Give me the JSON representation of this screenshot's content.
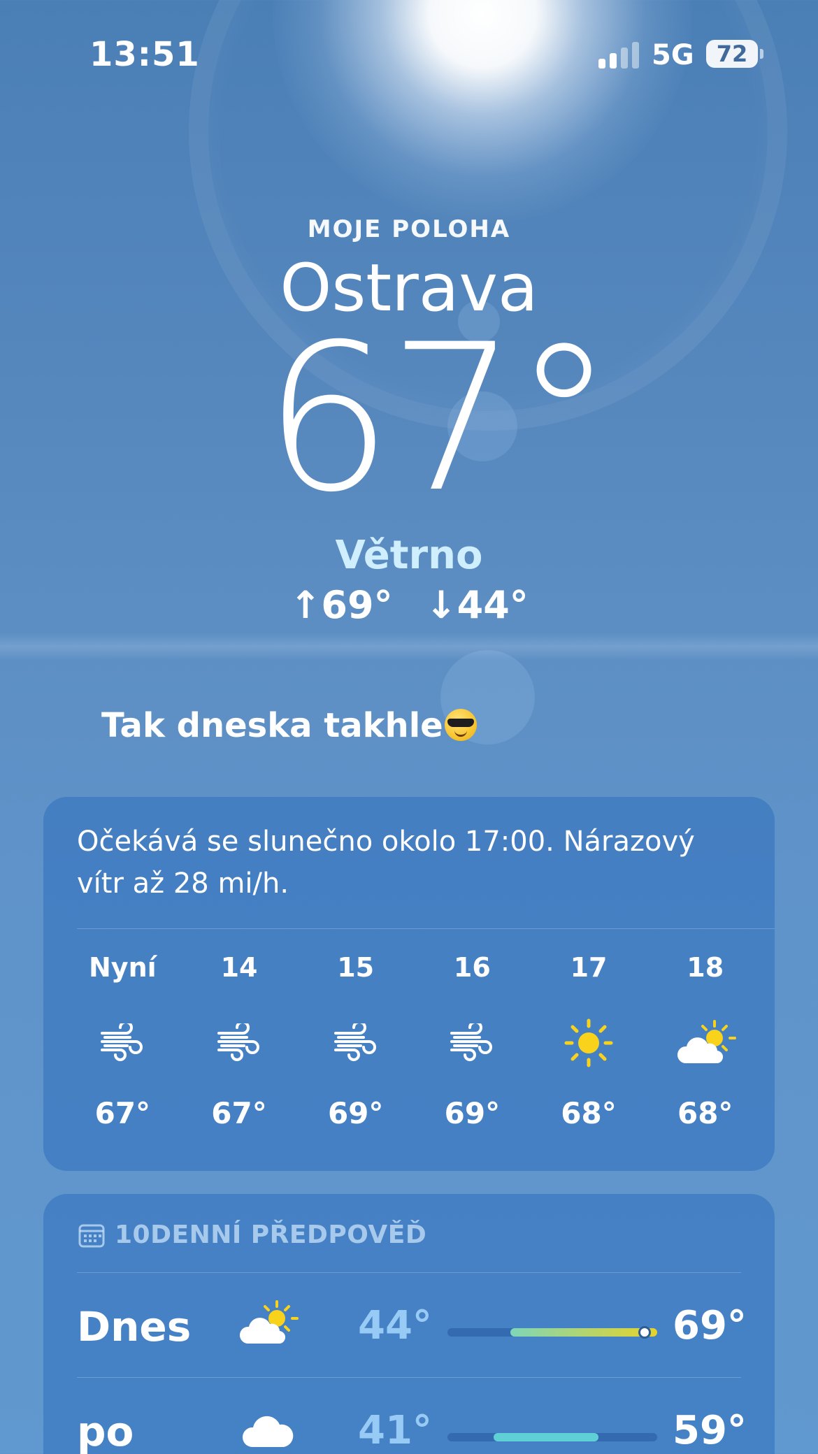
{
  "status_bar": {
    "time": "13:51",
    "network": "5G",
    "battery": "72"
  },
  "header": {
    "location_label": "MOJE POLOHA",
    "city": "Ostrava",
    "temperature": "67°",
    "condition": "Větrno",
    "high": "↑69°",
    "low": "↓44°"
  },
  "caption": "Tak dneska takhle",
  "hourly": {
    "summary": "Očekává se slunečno okolo 17:00. Nárazový vítr až 28 mi/h.",
    "items": [
      {
        "label": "Nyní",
        "icon": "wind-icon",
        "temp": "67°"
      },
      {
        "label": "14",
        "icon": "wind-icon",
        "temp": "67°"
      },
      {
        "label": "15",
        "icon": "wind-icon",
        "temp": "69°"
      },
      {
        "label": "16",
        "icon": "wind-icon",
        "temp": "69°"
      },
      {
        "label": "17",
        "icon": "sun-icon",
        "temp": "68°"
      },
      {
        "label": "18",
        "icon": "partly-cloudy-icon",
        "temp": "68°"
      }
    ]
  },
  "daily": {
    "title": "10DENNÍ PŘEDPOVĚĎ",
    "days": [
      {
        "name": "Dnes",
        "icon": "partly-cloudy-icon",
        "low": "44°",
        "high": "69°",
        "range_start": 0.3,
        "range_end": 1.0,
        "current": 0.94
      },
      {
        "name": "po",
        "icon": "cloud-icon",
        "low": "41°",
        "high": "59°",
        "range_start": 0.22,
        "range_end": 0.72
      }
    ]
  },
  "colors": {
    "condition": "#cfeefe",
    "sun": "#f8d21b",
    "range_today": "#7fd6b8",
    "range_today_end": "#e6d32a",
    "range_tomorrow": "#5fd0d6"
  }
}
